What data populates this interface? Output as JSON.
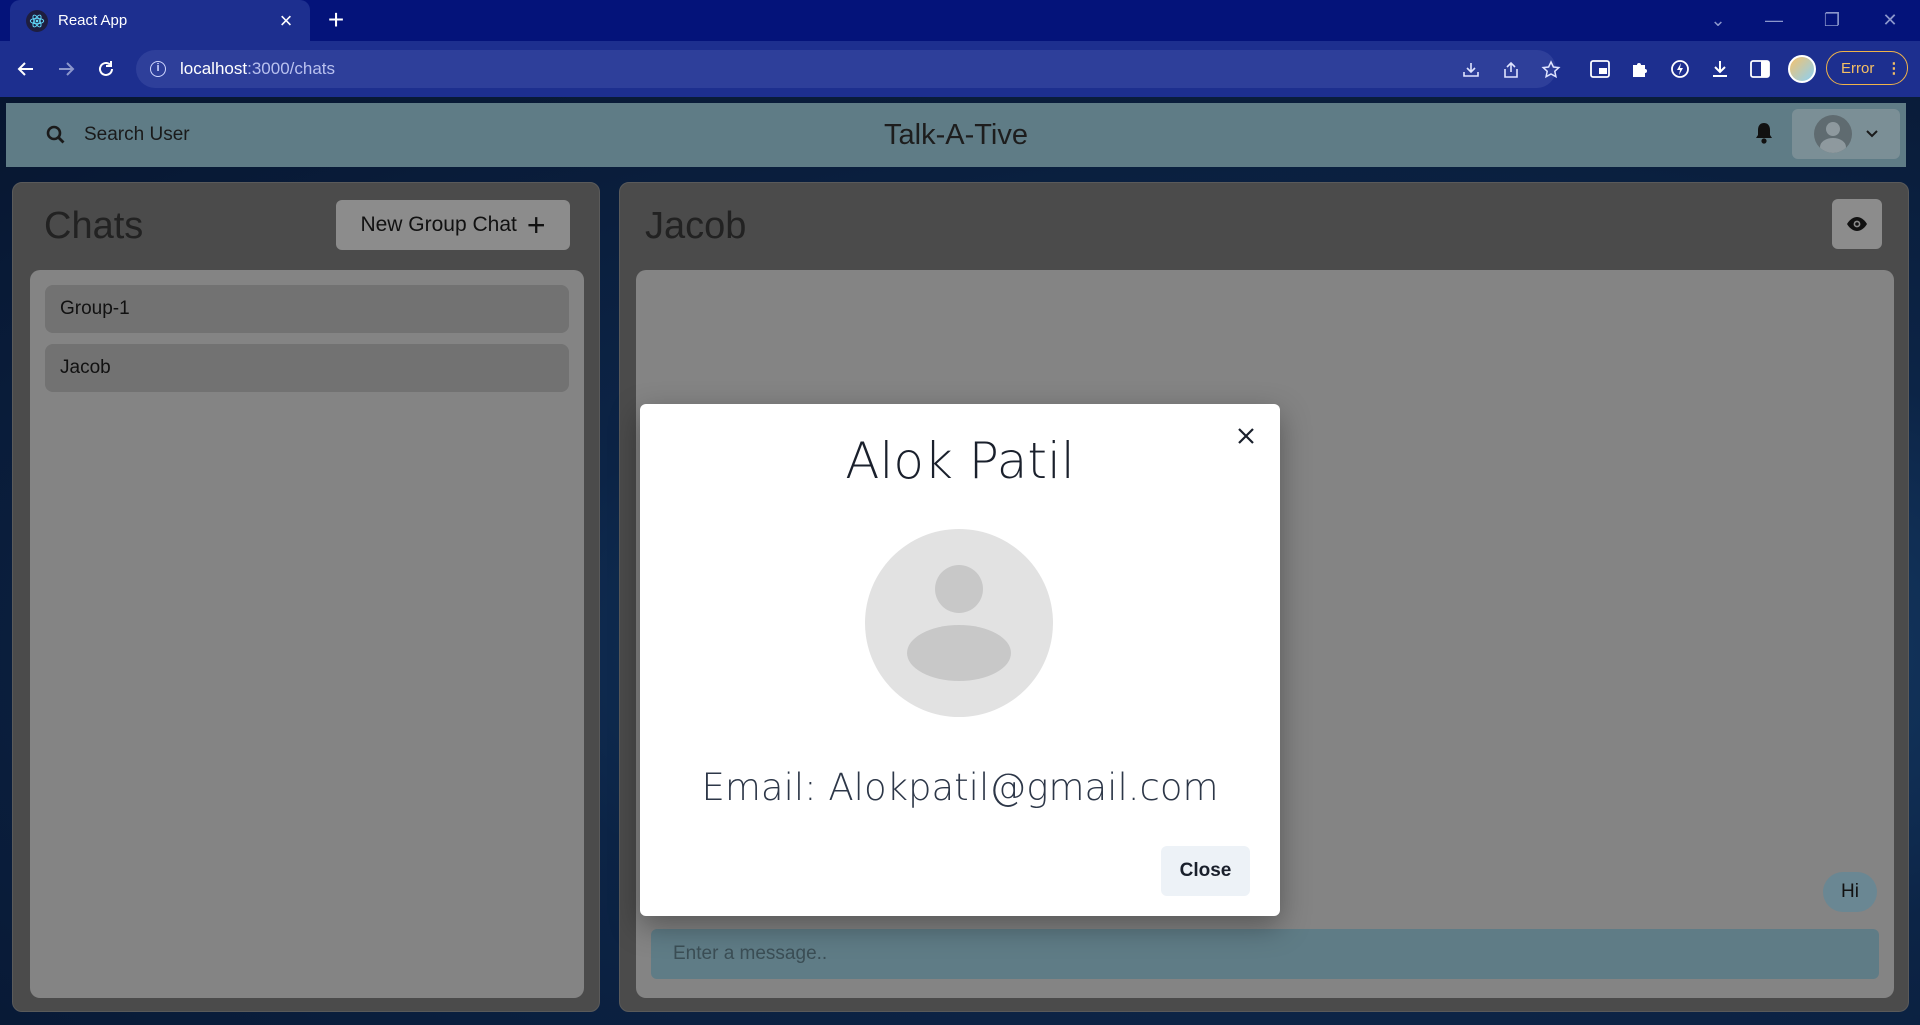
{
  "browser": {
    "tab_title": "React App",
    "url_host": "localhost",
    "url_path": ":3000/chats",
    "error_label": "Error"
  },
  "header": {
    "search_label": "Search User",
    "brand": "Talk-A-Tive"
  },
  "chats_panel": {
    "title": "Chats",
    "new_group_label": "New Group Chat",
    "items": [
      {
        "label": "Group-1"
      },
      {
        "label": "Jacob"
      }
    ]
  },
  "chat_view": {
    "title": "Jacob",
    "messages": [
      {
        "text": "Hi"
      }
    ],
    "input_placeholder": "Enter a message.."
  },
  "profile_modal": {
    "name": "Alok Patil",
    "email": "Email: Alokpatil@gmail.com",
    "close_label": "Close"
  },
  "colors": {
    "tab_bg": "#04137a",
    "toolbar_bg": "#1d2f8f",
    "header_teal": "#5f7c86",
    "panel_gray": "#4b4b4b"
  }
}
